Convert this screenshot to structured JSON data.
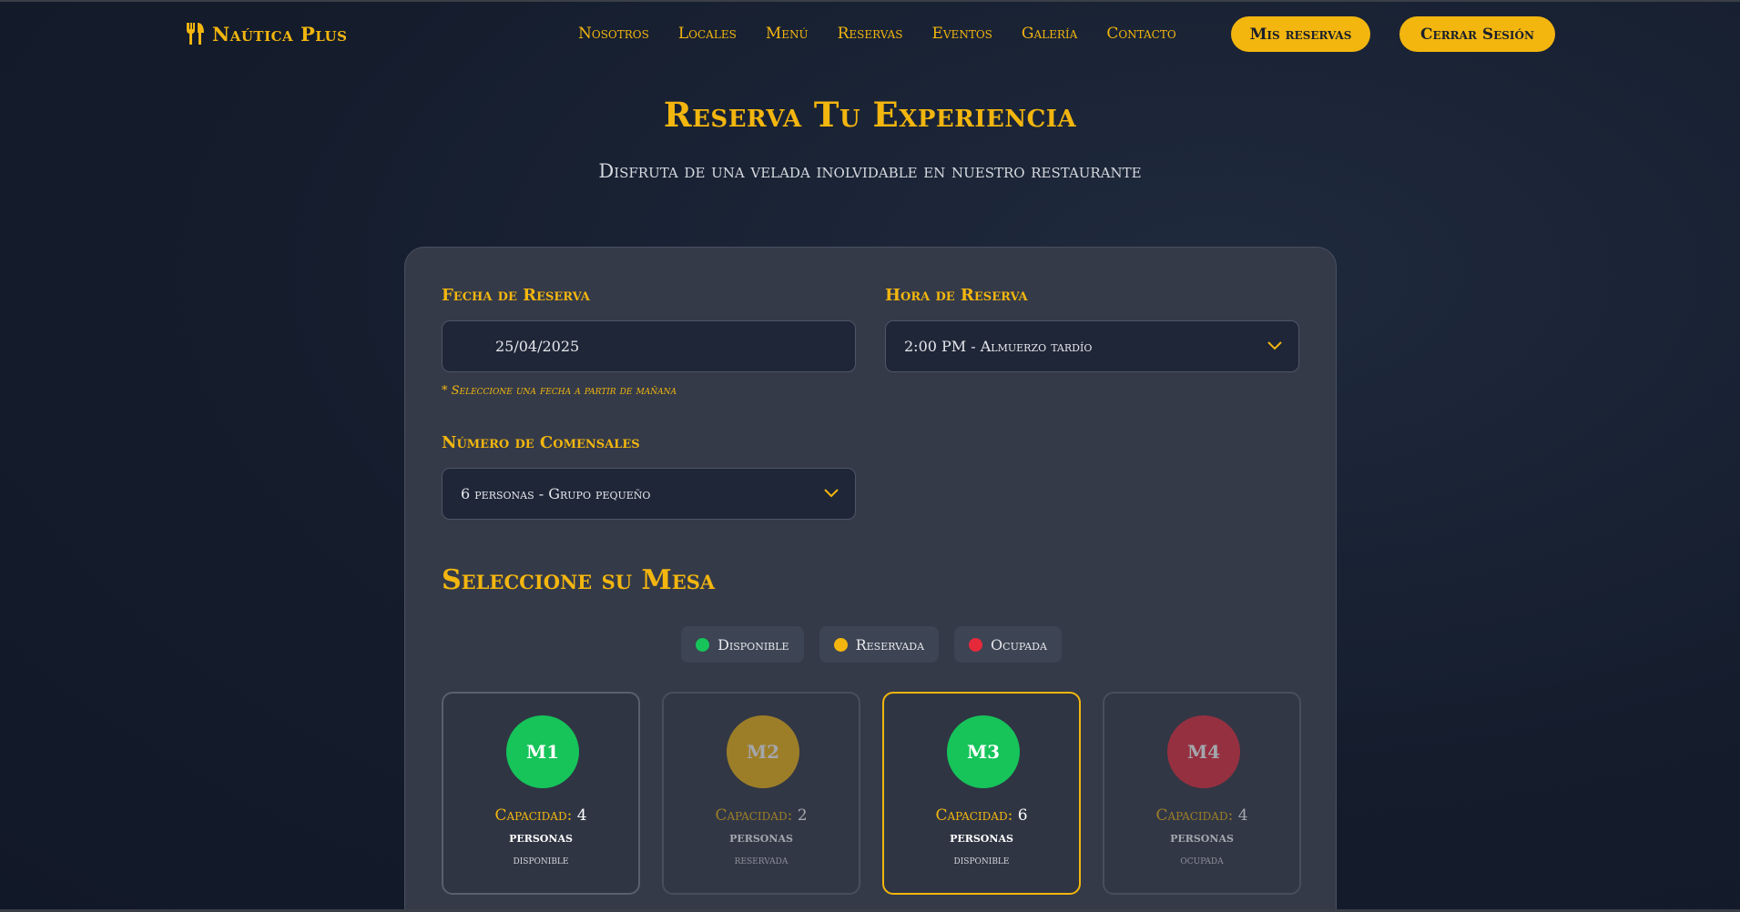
{
  "brand": {
    "name": "Naútica Plus",
    "icon": "utensils-icon"
  },
  "nav": {
    "links": [
      "Nosotros",
      "Locales",
      "Menú",
      "Reservas",
      "Eventos",
      "Galería",
      "Contacto"
    ],
    "mis_reservas": "Mis reservas",
    "cerrar_sesion": "Cerrar Sesión"
  },
  "hero": {
    "title": "Reserva Tu Experiencia",
    "subtitle": "Disfruta de una velada inolvidable en nuestro restaurante"
  },
  "form": {
    "fecha": {
      "label": "Fecha de Reserva",
      "value": "25/04/2025",
      "hint": "* Seleccione una fecha a partir de mañana"
    },
    "hora": {
      "label": "Hora de Reserva",
      "value": "2:00 PM - Almuerzo tardío"
    },
    "comensales": {
      "label": "Número de Comensales",
      "value": "6 personas - Grupo pequeño"
    }
  },
  "mesas": {
    "title": "Seleccione su Mesa",
    "legend": [
      {
        "label": "Disponible",
        "color": "#16c45a"
      },
      {
        "label": "Reservada",
        "color": "#f3b60f"
      },
      {
        "label": "Ocupada",
        "color": "#e5293b"
      }
    ],
    "capacity_label": "Capacidad:",
    "tables": [
      {
        "id": "M1",
        "capacity": "4",
        "unit": "personas",
        "status": "disponible",
        "color": "#16c45a"
      },
      {
        "id": "M2",
        "capacity": "2",
        "unit": "personas",
        "status": "reservada",
        "color": "#f3b60f"
      },
      {
        "id": "M3",
        "capacity": "6",
        "unit": "personas",
        "status": "disponible",
        "color": "#16c45a"
      },
      {
        "id": "M4",
        "capacity": "4",
        "unit": "personas",
        "status": "ocupada",
        "color": "#e5293b"
      }
    ]
  },
  "colors": {
    "accent": "#f3b60f",
    "background": "#151d2d",
    "card": "#343a48"
  }
}
